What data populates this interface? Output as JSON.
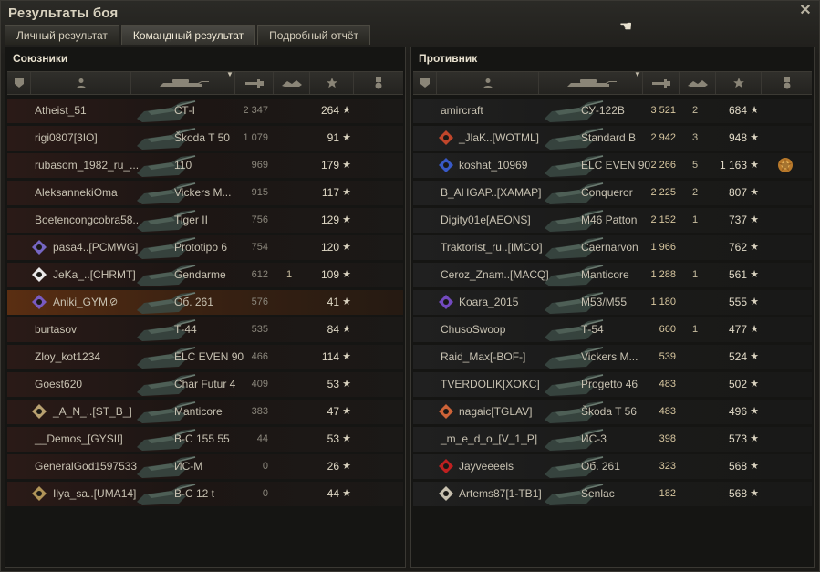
{
  "window": {
    "title": "Результаты боя"
  },
  "tabs": [
    {
      "label": "Личный результат",
      "active": false
    },
    {
      "label": "Командный результат",
      "active": true
    },
    {
      "label": "Подробный отчёт",
      "active": false
    }
  ],
  "columns": [
    "squad-icon",
    "player-icon",
    "tank-icon",
    "damage-icon",
    "kills-icon",
    "experience-star-icon",
    "medal-icon"
  ],
  "allies": {
    "title": "Союзники",
    "rows": [
      {
        "player": "Atheist_51",
        "clan": null,
        "tank": "СТ-I",
        "damage": "2 347",
        "kills": "",
        "xp": "264",
        "self": false
      },
      {
        "player": "rigi0807[3IO]",
        "clan": null,
        "tank": "Škoda T 50",
        "damage": "1 079",
        "kills": "",
        "xp": "91",
        "self": false
      },
      {
        "player": "rubasom_1982_ru_...",
        "clan": null,
        "tank": "110",
        "damage": "969",
        "kills": "",
        "xp": "179",
        "self": false
      },
      {
        "player": "AleksannekiOma",
        "clan": null,
        "tank": "Vickers M...",
        "damage": "915",
        "kills": "",
        "xp": "117",
        "self": false
      },
      {
        "player": "Boetencongcobra58..",
        "clan": null,
        "tank": "Tiger II",
        "damage": "756",
        "kills": "",
        "xp": "129",
        "self": false
      },
      {
        "player": "pasa4..[PCMWG]",
        "clan": "pcmwg",
        "tank": "Prototipo 6",
        "damage": "754",
        "kills": "",
        "xp": "120",
        "self": false
      },
      {
        "player": "JeKa_..[CHRMT]",
        "clan": "chrmt",
        "tank": "Gendarme",
        "damage": "612",
        "kills": "1",
        "xp": "109",
        "self": false
      },
      {
        "player": "Aniki_GYM..",
        "clan": "gym",
        "tank": "Об. 261",
        "damage": "576",
        "kills": "",
        "xp": "41",
        "self": true
      },
      {
        "player": "burtasov",
        "clan": null,
        "tank": "Т-44",
        "damage": "535",
        "kills": "",
        "xp": "84",
        "self": false
      },
      {
        "player": "Zloy_kot1234",
        "clan": null,
        "tank": "ELC EVEN 90",
        "damage": "466",
        "kills": "",
        "xp": "114",
        "self": false
      },
      {
        "player": "Goest620",
        "clan": null,
        "tank": "Char Futur 4",
        "damage": "409",
        "kills": "",
        "xp": "53",
        "self": false
      },
      {
        "player": "_A_N_..[ST_B_]",
        "clan": "stb",
        "tank": "Manticore",
        "damage": "383",
        "kills": "",
        "xp": "47",
        "self": false
      },
      {
        "player": "__Demos_[GYSII]",
        "clan": null,
        "tank": "В-С 155 55",
        "damage": "44",
        "kills": "",
        "xp": "53",
        "self": false
      },
      {
        "player": "GeneralGod1597533",
        "clan": null,
        "tank": "ИС-М",
        "damage": "0",
        "kills": "",
        "xp": "26",
        "self": false
      },
      {
        "player": "Ilya_sa..[UMA14]",
        "clan": "uma",
        "tank": "В-С 12 t",
        "damage": "0",
        "kills": "",
        "xp": "44",
        "self": false
      }
    ]
  },
  "enemies": {
    "title": "Противник",
    "rows": [
      {
        "player": "amircraft",
        "clan": null,
        "tank": "СУ-122В",
        "damage": "3 521",
        "kills": "2",
        "xp": "684",
        "medal": false
      },
      {
        "player": "_JlaK..[WOTML]",
        "clan": "wotml",
        "tank": "Standard B",
        "damage": "2 942",
        "kills": "3",
        "xp": "948",
        "medal": false
      },
      {
        "player": "koshat_10969",
        "clan": "koshat",
        "tank": "ELC EVEN 90",
        "damage": "2 266",
        "kills": "5",
        "xp": "1 163",
        "medal": true
      },
      {
        "player": "B_AHGAP..[XAMAP]",
        "clan": null,
        "tank": "Conqueror",
        "damage": "2 225",
        "kills": "2",
        "xp": "807",
        "medal": false
      },
      {
        "player": "Digity01e[AEONS]",
        "clan": null,
        "tank": "M46 Patton",
        "damage": "2 152",
        "kills": "1",
        "xp": "737",
        "medal": false
      },
      {
        "player": "Traktorist_ru..[IMCO]",
        "clan": null,
        "tank": "Caernarvon",
        "damage": "1 966",
        "kills": "",
        "xp": "762",
        "medal": false
      },
      {
        "player": "Ceroz_Znam..[MACQ]",
        "clan": null,
        "tank": "Manticore",
        "damage": "1 288",
        "kills": "1",
        "xp": "561",
        "medal": false
      },
      {
        "player": "Koara_2015",
        "clan": "koara",
        "tank": "M53/M55",
        "damage": "1 180",
        "kills": "",
        "xp": "555",
        "medal": false
      },
      {
        "player": "ChusoSwoop",
        "clan": null,
        "tank": "Т-54",
        "damage": "660",
        "kills": "1",
        "xp": "477",
        "medal": false
      },
      {
        "player": "Raid_Max[-BOF-]",
        "clan": null,
        "tank": "Vickers M...",
        "damage": "539",
        "kills": "",
        "xp": "524",
        "medal": false
      },
      {
        "player": "TVERDOLIK[XOKC]",
        "clan": null,
        "tank": "Progetto 46",
        "damage": "483",
        "kills": "",
        "xp": "502",
        "medal": false
      },
      {
        "player": "nagaic[TGLAV]",
        "clan": "tglav",
        "tank": "Škoda T 56",
        "damage": "483",
        "kills": "",
        "xp": "496",
        "medal": false
      },
      {
        "player": "_m_e_d_o_[V_1_P]",
        "clan": null,
        "tank": "ИС-3",
        "damage": "398",
        "kills": "",
        "xp": "573",
        "medal": false
      },
      {
        "player": "Jayveeeels",
        "clan": "jay",
        "tank": "Об. 261",
        "damage": "323",
        "kills": "",
        "xp": "568",
        "medal": false
      },
      {
        "player": "Artems87[1-TB1]",
        "clan": "artems",
        "tank": "Senlac",
        "damage": "182",
        "kills": "",
        "xp": "568",
        "medal": false
      }
    ]
  }
}
